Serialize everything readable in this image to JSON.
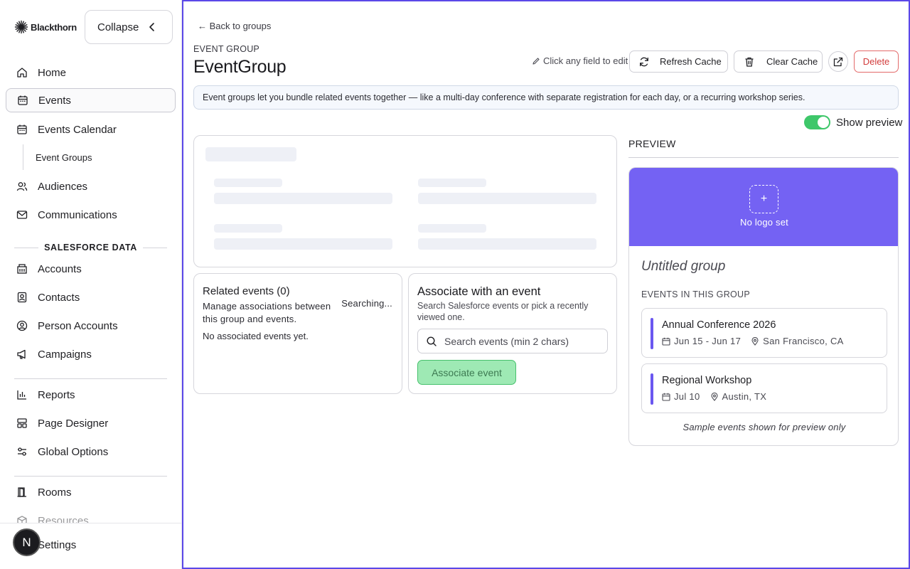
{
  "brand": {
    "name": "Blackthorn"
  },
  "sidebar": {
    "collapse_label": "Collapse",
    "items": [
      {
        "label": "Home",
        "icon": "home-icon"
      },
      {
        "label": "Events",
        "icon": "calendar-icon"
      },
      {
        "label": "Events Calendar",
        "icon": "calendar-icon"
      },
      {
        "label": "Audiences",
        "icon": "users-icon"
      },
      {
        "label": "Communications",
        "icon": "mail-icon"
      }
    ],
    "sub_item": {
      "label": "Event Groups"
    },
    "section_heading": "SALESFORCE DATA",
    "sf_items": [
      {
        "label": "Accounts",
        "icon": "building-icon"
      },
      {
        "label": "Contacts",
        "icon": "contact-icon"
      },
      {
        "label": "Person Accounts",
        "icon": "user-circle-icon"
      },
      {
        "label": "Campaigns",
        "icon": "megaphone-icon"
      }
    ],
    "tools": [
      {
        "label": "Reports",
        "icon": "bar-chart-icon"
      },
      {
        "label": "Page Designer",
        "icon": "layout-icon"
      },
      {
        "label": "Global Options",
        "icon": "sliders-icon"
      }
    ],
    "venue_items": [
      {
        "label": "Rooms",
        "icon": "door-icon"
      },
      {
        "label": "Resources",
        "icon": "box-icon"
      }
    ],
    "footer_label": "Settings",
    "avatar_initial": "N"
  },
  "header": {
    "back_label": "← Back to groups",
    "kicker": "EVENT GROUP",
    "title": "EventGroup",
    "edit_hint": "Click any field to edit",
    "refresh_label": "Refresh Cache",
    "clear_label": "Clear Cache",
    "delete_label": "Delete"
  },
  "info": "Event groups let you bundle related events together — like a multi-day conference with separate registration for each day, or a recurring workshop series.",
  "preview_toggle": {
    "label": "Show preview",
    "on": true
  },
  "related": {
    "title": "Related events (0)",
    "description": "Manage associations between this group and events.",
    "status": "Searching...",
    "empty": "No associated events yet."
  },
  "associate": {
    "title": "Associate with an event",
    "description": "Search Salesforce events or pick a recently viewed one.",
    "search_placeholder": "Search events (min 2 chars)",
    "button_label": "Associate event"
  },
  "preview": {
    "heading": "PREVIEW",
    "logo_plus": "+",
    "logo_text": "No logo set",
    "group_name": "Untitled group",
    "events_heading": "EVENTS IN THIS GROUP",
    "events": [
      {
        "name": "Annual Conference 2026",
        "dates": "Jun 15 - Jun 17",
        "location": "San Francisco, CA"
      },
      {
        "name": "Regional Workshop",
        "dates": "Jul 10",
        "location": "Austin, TX"
      }
    ],
    "note": "Sample events shown for preview only"
  },
  "colors": {
    "accent": "#5b48e8",
    "banner": "#7462f3",
    "success": "#3ec76a",
    "danger": "#d23b3b"
  }
}
